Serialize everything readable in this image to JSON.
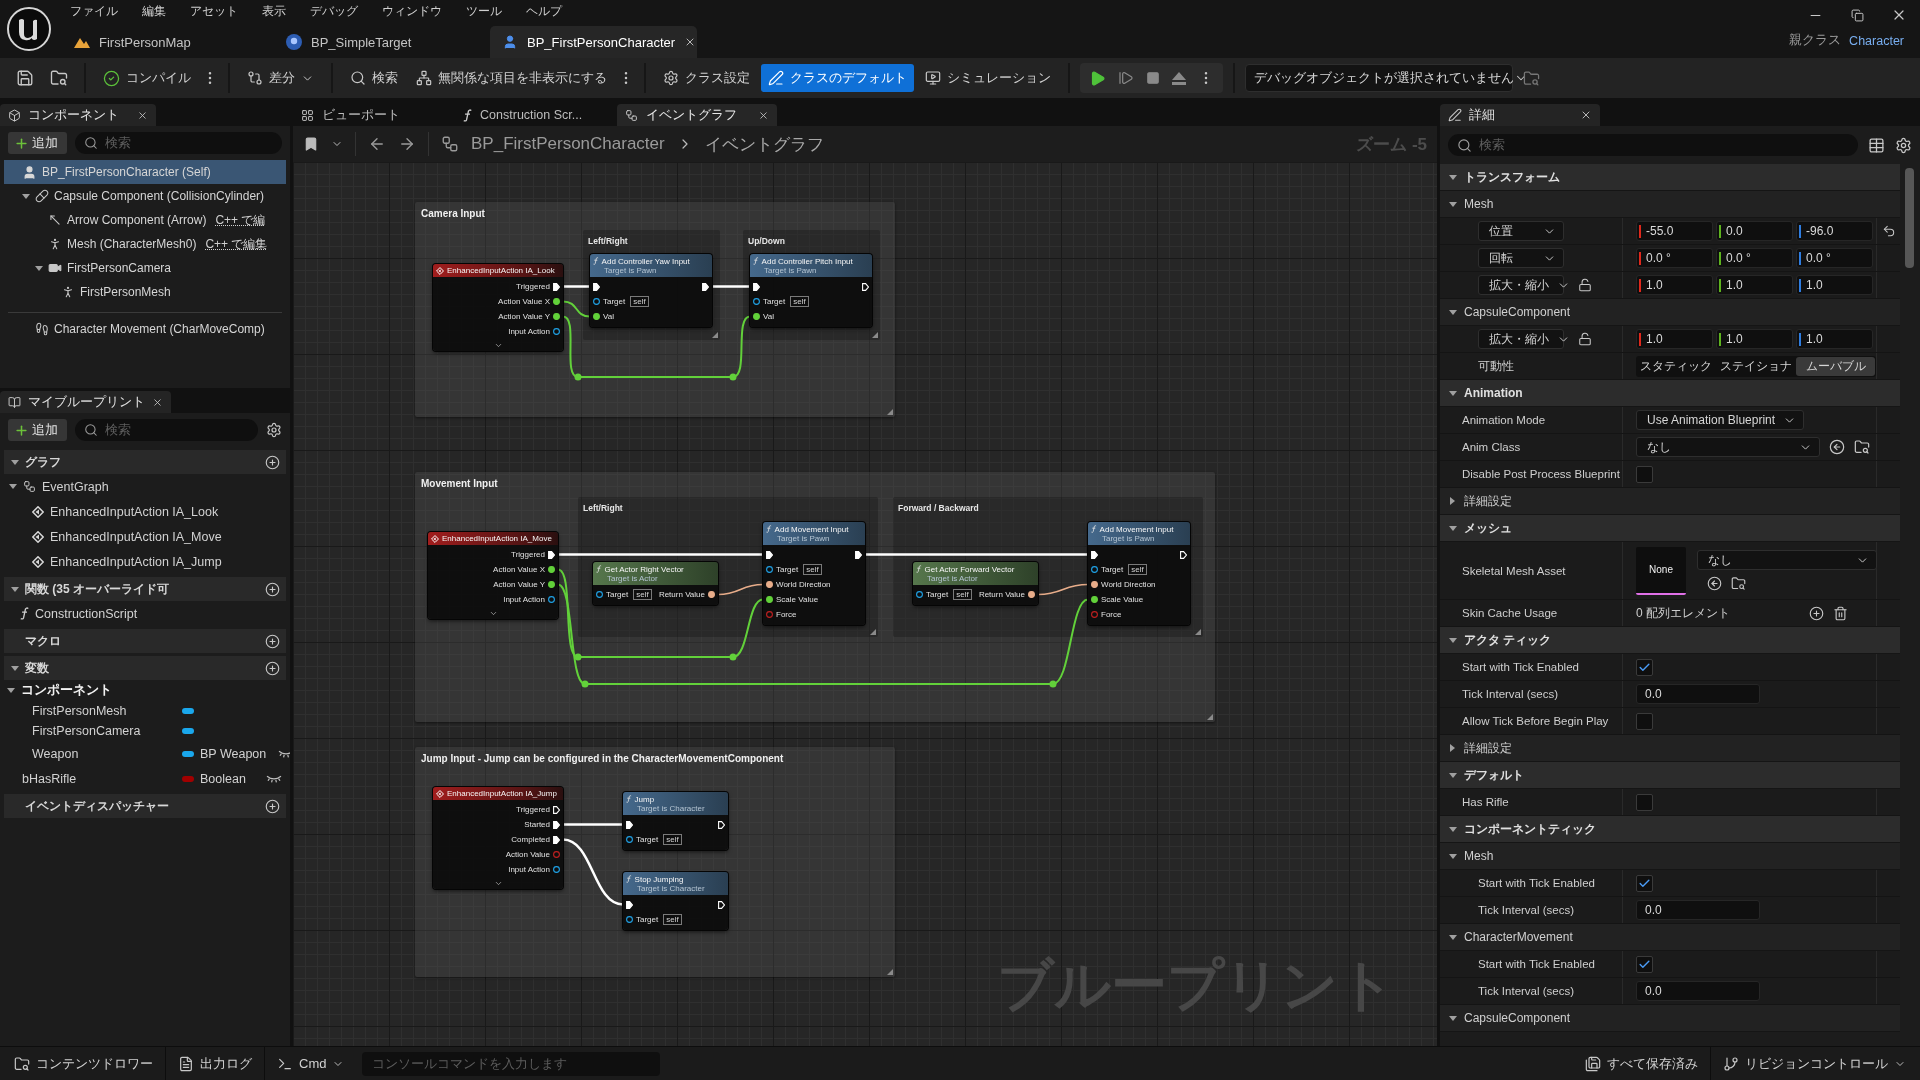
{
  "menu_bar": [
    "ファイル",
    "編集",
    "アセット",
    "表示",
    "デバッグ",
    "ウィンドウ",
    "ツール",
    "ヘルプ"
  ],
  "document_tabs": [
    {
      "label": "FirstPersonMap",
      "kind": "map",
      "selected": false
    },
    {
      "label": "BP_SimpleTarget",
      "kind": "blueprint",
      "selected": false
    },
    {
      "label": "BP_FirstPersonCharacter",
      "kind": "character",
      "selected": true
    }
  ],
  "parent_class": {
    "label": "親クラス",
    "value": "Character"
  },
  "toolbar": {
    "compile": "コンパイル",
    "diff": "差分",
    "find": "検索",
    "hide_unrelated": "無関係な項目を非表示にする",
    "class_settings": "クラス設定",
    "class_defaults": {
      "label": "クラスのデフォルト",
      "selected": true
    },
    "simulation": "シミュレーション",
    "debug_object": "デバッグオブジェクトが選択されていません"
  },
  "components_panel": {
    "title": "コンポーネント",
    "add_button": "追加",
    "search_placeholder": "検索",
    "tree": [
      {
        "label": "BP_FirstPersonCharacter (Self)",
        "kind": "self",
        "selected": true,
        "children": [
          {
            "label": "Capsule Component (CollisionCylinder)",
            "kind": "capsule",
            "selected": false,
            "expanded": true,
            "children": [
              {
                "label": "Arrow Component (Arrow)",
                "kind": "arrow",
                "selected": false,
                "link": "C++ で編"
              },
              {
                "label": "Mesh (CharacterMesh0)",
                "kind": "mesh",
                "selected": false,
                "link": "C++ で編集"
              },
              {
                "label": "FirstPersonCamera",
                "kind": "camera",
                "selected": false,
                "expanded": true,
                "children": [
                  {
                    "label": "FirstPersonMesh",
                    "kind": "mesh",
                    "selected": false
                  }
                ]
              }
            ]
          }
        ]
      }
    ],
    "movement": [
      {
        "label": "Character Movement (CharMoveComp)",
        "kind": "movement",
        "selected": false
      }
    ]
  },
  "my_blueprint_panel": {
    "title": "マイブループリント",
    "add_button": "追加",
    "search_placeholder": "検索",
    "sections": [
      {
        "title": "グラフ",
        "expanded": true,
        "items": [
          {
            "label": "EventGraph",
            "kind": "graph",
            "expanded": true,
            "children": [
              {
                "label": "EnhancedInputAction IA_Look",
                "kind": "event"
              },
              {
                "label": "EnhancedInputAction IA_Move",
                "kind": "event"
              },
              {
                "label": "EnhancedInputAction IA_Jump",
                "kind": "event"
              }
            ]
          }
        ]
      },
      {
        "title": "関数 (35 オーバーライド可",
        "expanded": true,
        "items": [
          {
            "label": "ConstructionScript",
            "kind": "function"
          }
        ]
      },
      {
        "title": "マクロ"
      },
      {
        "title": "変数",
        "expanded": true,
        "categories": [
          {
            "title": "コンポーネント",
            "expanded": true,
            "variables": [
              {
                "name": "FirstPersonMesh",
                "color": "#1aa7ec"
              },
              {
                "name": "FirstPersonCamera",
                "color": "#1aa7ec"
              },
              {
                "name": "Weapon",
                "type": "BP Weapon",
                "color": "#1aa7ec",
                "public": false
              }
            ]
          }
        ],
        "variables": [
          {
            "name": "bHasRifle",
            "type": "Boolean",
            "color": "#a10000",
            "public": false
          }
        ]
      },
      {
        "title": "イベントディスパッチャー"
      }
    ]
  },
  "graph_tabs": [
    {
      "label": "ビューポート",
      "kind": "viewport",
      "selected": false
    },
    {
      "label": "Construction Scr...",
      "kind": "function",
      "selected": false
    },
    {
      "label": "イベントグラフ",
      "kind": "graph",
      "selected": true
    }
  ],
  "graph_toolbar": {
    "breadcrumb": [
      "BP_FirstPersonCharacter",
      "イベントグラフ"
    ],
    "zoom": "ズーム -5"
  },
  "graph": {
    "watermark": "ブループリント",
    "comments": [
      {
        "title": "Camera Input",
        "groups": [
          "Left/Right",
          "Up/Down"
        ]
      },
      {
        "title": "Movement Input",
        "groups": [
          "Left/Right",
          "Forward / Backward"
        ]
      },
      {
        "title": "Jump Input - Jump can be configured in the CharacterMovementComponent"
      }
    ],
    "nodes": [
      {
        "kind": "event",
        "title": "EnhancedInputAction IA_Look",
        "outputs": [
          {
            "label": "Triggered",
            "kind": "exec",
            "linked": true
          },
          {
            "label": "Action Value X",
            "kind": "float",
            "linked": true
          },
          {
            "label": "Action Value Y",
            "kind": "float",
            "linked": true
          },
          {
            "label": "Input Action",
            "kind": "object",
            "linked": false
          }
        ]
      },
      {
        "kind": "function",
        "title": "Add Controller Yaw Input",
        "subtitle": "Target is Pawn",
        "exec": {
          "in_linked": true,
          "out_linked": true
        },
        "inputs": [
          {
            "label": "Target",
            "kind": "object",
            "linked": false,
            "default": "self"
          },
          {
            "label": "Val",
            "kind": "float",
            "linked": true
          }
        ]
      },
      {
        "kind": "function",
        "title": "Add Controller Pitch Input",
        "subtitle": "Target is Pawn",
        "exec": {
          "in_linked": true,
          "out_linked": false
        },
        "inputs": [
          {
            "label": "Target",
            "kind": "object",
            "linked": false,
            "default": "self"
          },
          {
            "label": "Val",
            "kind": "float",
            "linked": true
          }
        ]
      },
      {
        "kind": "event",
        "title": "EnhancedInputAction IA_Move",
        "outputs": [
          {
            "label": "Triggered",
            "kind": "exec",
            "linked": true
          },
          {
            "label": "Action Value X",
            "kind": "float",
            "linked": true
          },
          {
            "label": "Action Value Y",
            "kind": "float",
            "linked": true
          },
          {
            "label": "Input Action",
            "kind": "object",
            "linked": false
          }
        ]
      },
      {
        "kind": "pure",
        "title": "Get Actor Right Vector",
        "subtitle": "Target is Actor",
        "inputs": [
          {
            "label": "Target",
            "kind": "object",
            "linked": false,
            "default": "self"
          }
        ],
        "outputs": [
          {
            "label": "Return Value",
            "kind": "vector",
            "linked": true
          }
        ]
      },
      {
        "kind": "function",
        "title": "Add Movement Input",
        "subtitle": "Target is Pawn",
        "exec": {
          "in_linked": true,
          "out_linked": true
        },
        "inputs": [
          {
            "label": "Target",
            "kind": "object",
            "linked": false,
            "default": "self"
          },
          {
            "label": "World Direction",
            "kind": "vector",
            "linked": true
          },
          {
            "label": "Scale Value",
            "kind": "float",
            "linked": true
          },
          {
            "label": "Force",
            "kind": "bool",
            "linked": false
          }
        ]
      },
      {
        "kind": "pure",
        "title": "Get Actor Forward Vector",
        "subtitle": "Target is Actor",
        "inputs": [
          {
            "label": "Target",
            "kind": "object",
            "linked": false,
            "default": "self"
          }
        ],
        "outputs": [
          {
            "label": "Return Value",
            "kind": "vector",
            "linked": true
          }
        ]
      },
      {
        "kind": "function",
        "title": "Add Movement Input",
        "subtitle": "Target is Pawn",
        "exec": {
          "in_linked": true,
          "out_linked": false
        },
        "inputs": [
          {
            "label": "Target",
            "kind": "object",
            "linked": false,
            "default": "self"
          },
          {
            "label": "World Direction",
            "kind": "vector",
            "linked": true
          },
          {
            "label": "Scale Value",
            "kind": "float",
            "linked": true
          },
          {
            "label": "Force",
            "kind": "bool",
            "linked": false
          }
        ]
      },
      {
        "kind": "event",
        "title": "EnhancedInputAction IA_Jump",
        "outputs": [
          {
            "label": "Triggered",
            "kind": "exec",
            "linked": false
          },
          {
            "label": "Started",
            "kind": "exec",
            "linked": true
          },
          {
            "label": "Completed",
            "kind": "exec",
            "linked": true
          },
          {
            "label": "Action Value",
            "kind": "bool",
            "linked": false
          },
          {
            "label": "Input Action",
            "kind": "object",
            "linked": false
          }
        ]
      },
      {
        "kind": "function",
        "title": "Jump",
        "subtitle": "Target is Character",
        "exec": {
          "in_linked": true,
          "out_linked": false
        },
        "inputs": [
          {
            "label": "Target",
            "kind": "object",
            "linked": false,
            "default": "self"
          }
        ]
      },
      {
        "kind": "function",
        "title": "Stop Jumping",
        "subtitle": "Target is Character",
        "exec": {
          "in_linked": true,
          "out_linked": false
        },
        "inputs": [
          {
            "label": "Target",
            "kind": "object",
            "linked": false,
            "default": "self"
          }
        ]
      }
    ]
  },
  "details_panel": {
    "title": "詳細",
    "search_placeholder": "検索",
    "sections": [
      {
        "title": "トランスフォーム",
        "expanded": true,
        "rows": [
          {
            "kind": "group",
            "label": "Mesh",
            "expanded": true,
            "rows": [
              {
                "kind": "vector",
                "label": "位置",
                "resettable": true,
                "values": [
                  {
                    "text": "-55.0",
                    "color": "#e0281c"
                  },
                  {
                    "text": "0.0",
                    "color": "#5db31e"
                  },
                  {
                    "text": "-96.0",
                    "color": "#2f7de0"
                  }
                ]
              },
              {
                "kind": "vector",
                "label": "回転",
                "values": [
                  {
                    "text": "0.0 °",
                    "color": "#e0281c"
                  },
                  {
                    "text": "0.0 °",
                    "color": "#5db31e"
                  },
                  {
                    "text": "0.0 °",
                    "color": "#2f7de0"
                  }
                ]
              },
              {
                "kind": "vector",
                "label": "拡大・縮小",
                "locked": false,
                "values": [
                  {
                    "text": "1.0",
                    "color": "#e0281c"
                  },
                  {
                    "text": "1.0",
                    "color": "#5db31e"
                  },
                  {
                    "text": "1.0",
                    "color": "#2f7de0"
                  }
                ]
              }
            ]
          },
          {
            "kind": "group",
            "label": "CapsuleComponent",
            "expanded": true,
            "rows": [
              {
                "kind": "vector",
                "label": "拡大・縮小",
                "locked": false,
                "values": [
                  {
                    "text": "1.0",
                    "color": "#e0281c"
                  },
                  {
                    "text": "1.0",
                    "color": "#5db31e"
                  },
                  {
                    "text": "1.0",
                    "color": "#2f7de0"
                  }
                ]
              },
              {
                "kind": "segmented",
                "label": "可動性",
                "options": [
                  {
                    "label": "スタティック",
                    "selected": false
                  },
                  {
                    "label": "ステイショナ",
                    "selected": false
                  },
                  {
                    "label": "ムーバブル",
                    "selected": true
                  }
                ]
              }
            ]
          }
        ]
      },
      {
        "title": "Animation",
        "expanded": true,
        "rows": [
          {
            "kind": "dropdown",
            "label": "Animation Mode",
            "value": "Use Animation Blueprint"
          },
          {
            "kind": "asset",
            "label": "Anim Class",
            "value": "なし"
          },
          {
            "kind": "checkbox",
            "label": "Disable Post Process Blueprint",
            "checked": false
          },
          {
            "kind": "group",
            "label": "詳細設定",
            "expanded": false
          }
        ]
      },
      {
        "title": "メッシュ",
        "expanded": true,
        "rows": [
          {
            "kind": "thumbnail",
            "label": "Skeletal Mesh Asset",
            "thumbnail": "None",
            "value": "なし"
          },
          {
            "kind": "array",
            "label": "Skin Cache Usage",
            "value": "0 配列エレメント"
          }
        ]
      },
      {
        "title": "アクタ ティック",
        "expanded": true,
        "rows": [
          {
            "kind": "checkbox",
            "label": "Start with Tick Enabled",
            "checked": true
          },
          {
            "kind": "number",
            "label": "Tick Interval (secs)",
            "value": "0.0"
          },
          {
            "kind": "checkbox",
            "label": "Allow Tick Before Begin Play",
            "checked": false
          },
          {
            "kind": "group",
            "label": "詳細設定",
            "expanded": false
          }
        ]
      },
      {
        "title": "デフォルト",
        "expanded": true,
        "rows": [
          {
            "kind": "checkbox",
            "label": "Has Rifle",
            "checked": false
          }
        ]
      },
      {
        "title": "コンポーネントティック",
        "expanded": true,
        "rows": [
          {
            "kind": "group",
            "label": "Mesh",
            "expanded": true,
            "rows": [
              {
                "kind": "checkbox",
                "label": "Start with Tick Enabled",
                "checked": true
              },
              {
                "kind": "number",
                "label": "Tick Interval (secs)",
                "value": "0.0"
              }
            ]
          },
          {
            "kind": "group",
            "label": "CharacterMovement",
            "expanded": true,
            "rows": [
              {
                "kind": "checkbox",
                "label": "Start with Tick Enabled",
                "checked": true
              },
              {
                "kind": "number",
                "label": "Tick Interval (secs)",
                "value": "0.0"
              }
            ]
          },
          {
            "kind": "group",
            "label": "CapsuleComponent",
            "expanded": true
          }
        ]
      }
    ]
  },
  "status_bar": {
    "content_drawer": "コンテンツドロワー",
    "output_log": "出力ログ",
    "cmd": "Cmd",
    "console_placeholder": "コンソールコマンドを入力します",
    "save_state": "すべて保存済み",
    "revision_control": "リビジョンコントロール"
  }
}
